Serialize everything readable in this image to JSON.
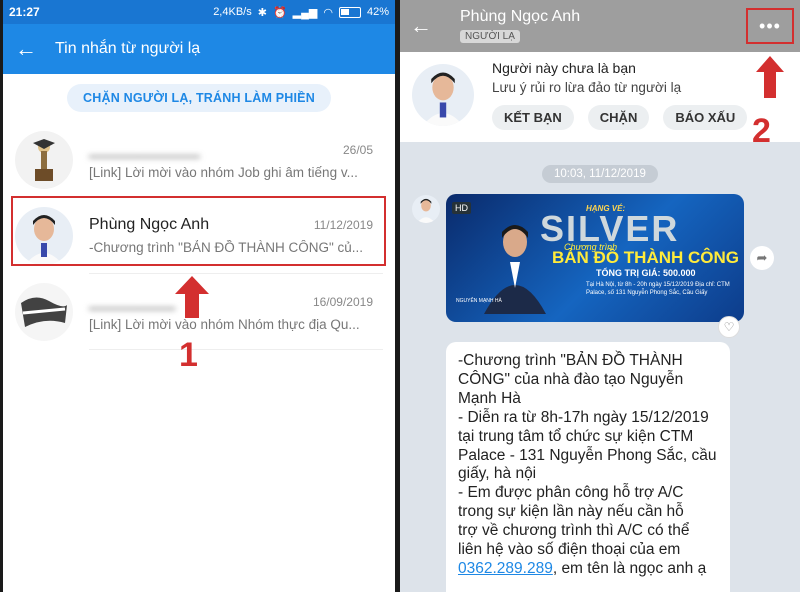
{
  "left_screen": {
    "status_bar": {
      "time": "21:27",
      "speed": "2,4KB/s",
      "battery": "42%"
    },
    "header": {
      "title": "Tin nhắn từ người lạ"
    },
    "block_button": "CHẶN NGƯỜI LẠ, TRÁNH LÀM PHIỀN",
    "conversations": [
      {
        "name": "",
        "date": "26/05",
        "preview": "[Link] Lời mời vào nhóm Job ghi âm tiếng v..."
      },
      {
        "name": "Phùng Ngọc Anh",
        "date": "11/12/2019",
        "preview": "-Chương trình \"BẢN ĐỒ THÀNH CÔNG\" củ..."
      },
      {
        "name": "",
        "date": "16/09/2019",
        "preview": "[Link] Lời mời vào nhóm Nhóm thực địa Qu..."
      }
    ],
    "step_label": "1"
  },
  "right_screen": {
    "header": {
      "name": "Phùng Ngọc Anh",
      "tag": "NGƯỜI LẠ",
      "more": "•••"
    },
    "stranger_card": {
      "title": "Người này chưa là bạn",
      "subtitle": "Lưu ý rủi ro lừa đảo từ người lạ",
      "actions": [
        "KẾT BẠN",
        "CHẶN",
        "BÁO XẤU"
      ]
    },
    "date_divider": "10:03, 11/12/2019",
    "banner": {
      "hd": "HD",
      "line1": "HẠNG VÉ:",
      "line2": "SILVER",
      "line3": "Chương trình",
      "line4": "BẢN ĐỒ THÀNH CÔNG",
      "line5": "TỔNG TRỊ GIÁ: 500.000",
      "line6": "Tại Hà Nội, từ 8h - 20h ngày 15/12/2019 Địa chỉ: CTM Palace, số 131 Nguyễn Phong Sắc, Cầu Giấy",
      "line7": "NGUYỄN MẠNH HÀ"
    },
    "message_lines": [
      "-Chương trình \"BẢN ĐỒ THÀNH",
      "CÔNG\" của nhà đào tạo Nguyễn",
      "Mạnh Hà",
      "- Diễn ra từ 8h-17h  ngày 15/12/2019",
      "tại trung tâm tổ chức sự kiện CTM",
      "Palace - 131 Nguyễn Phong Sắc, cầu",
      "giấy, hà nội",
      "- Em được phân công hỗ trợ A/C",
      "trong sự kiện lần này nếu cần hỗ",
      "trợ về chương trình thì A/C có thể",
      "liên hệ vào số điện thoại của em"
    ],
    "phone_number": "0362.289.289",
    "phone_suffix": ", em tên là ngọc anh ạ",
    "step_label": "2"
  },
  "colors": {
    "accent": "#1e88e5",
    "highlight": "#d32f2f"
  }
}
